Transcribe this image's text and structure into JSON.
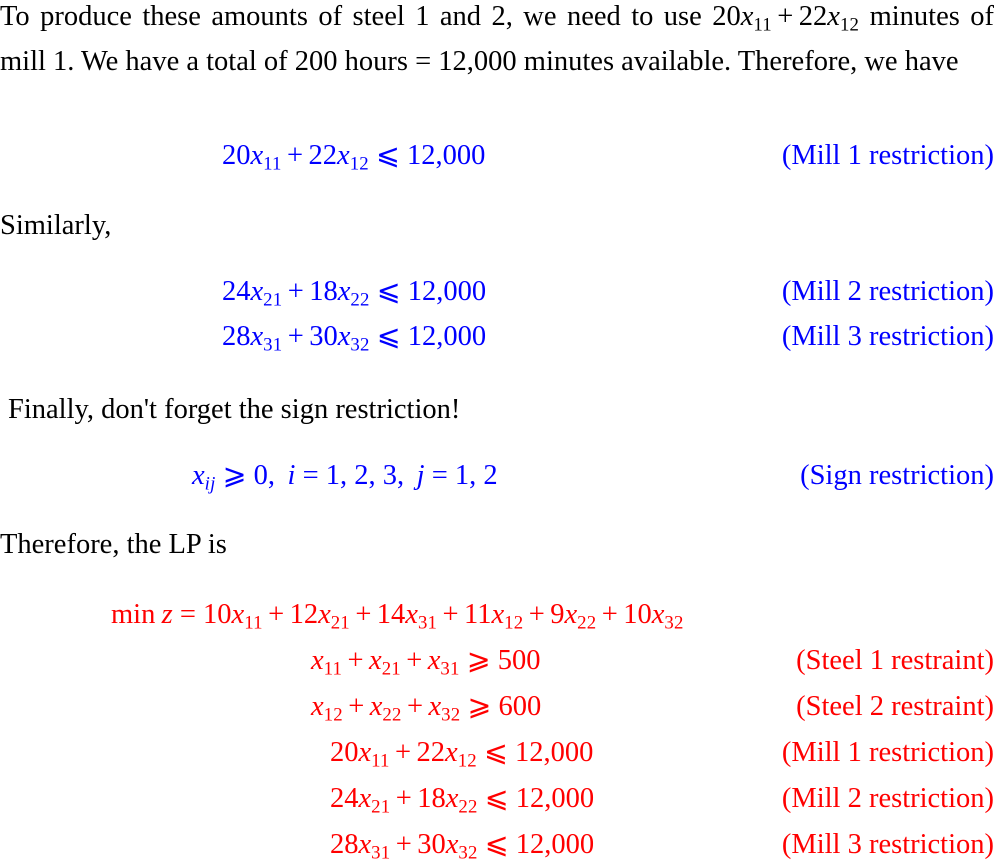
{
  "document": {
    "title": "Linear Programming formulation - steel mill problem",
    "colors": {
      "text": "#000000",
      "blue": "#0000ff",
      "red": "#ff0000",
      "background": "#ffffff"
    }
  },
  "paragraphs": {
    "intro": "To produce these amounts of steel 1 and 2, we need to use 20x11 + 22x12 minutes of mill 1. We have a total of 200 hours = 12,000 minutes available. Therefore, we have",
    "similarly": "Similarly,",
    "finally": "Finally, don't forget the sign restriction!",
    "therefore_lp": "Therefore, the LP is"
  },
  "intro_text": {
    "part1": "To produce these amounts of steel 1 and 2, we need to use ",
    "math1_coef1": "20",
    "math1_var1": "x",
    "math1_sub1": "11",
    "math1_op": "+",
    "math1_coef2": "22",
    "math1_var2": "x",
    "math1_sub2": "12",
    "part2": "minutes of mill 1. We have a total of 200 hours = 12,000 minutes available. Therefore, we have"
  },
  "equations": {
    "mill1_blue": {
      "coef1": "20",
      "var1": "x",
      "sub1": "11",
      "op": "+",
      "coef2": "22",
      "var2": "x",
      "sub2": "12",
      "rel": "⩽",
      "rhs": "12,000",
      "tag": "(Mill 1 restriction)",
      "color": "#0000ff"
    },
    "mill2_blue": {
      "coef1": "24",
      "var1": "x",
      "sub1": "21",
      "op": "+",
      "coef2": "18",
      "var2": "x",
      "sub2": "22",
      "rel": "⩽",
      "rhs": "12,000",
      "tag": "(Mill 2 restriction)",
      "color": "#0000ff"
    },
    "mill3_blue": {
      "coef1": "28",
      "var1": "x",
      "sub1": "31",
      "op": "+",
      "coef2": "30",
      "var2": "x",
      "sub2": "32",
      "rel": "⩽",
      "rhs": "12,000",
      "tag": "(Mill 3 restriction)",
      "color": "#0000ff"
    },
    "sign_blue": {
      "var": "x",
      "sub": "ij",
      "rel": "⩾",
      "rhs": "0,",
      "i_label": "i",
      "i_values": "1, 2, 3,",
      "j_label": "j",
      "j_values": "1, 2",
      "eq": "=",
      "tag": "(Sign restriction)",
      "color": "#0000ff"
    },
    "objective_red": {
      "min": "min",
      "z": "z",
      "eq": "=",
      "terms": [
        {
          "coef": "10",
          "var": "x",
          "sub": "11"
        },
        {
          "coef": "12",
          "var": "x",
          "sub": "21"
        },
        {
          "coef": "14",
          "var": "x",
          "sub": "31"
        },
        {
          "coef": "11",
          "var": "x",
          "sub": "12"
        },
        {
          "coef": "9",
          "var": "x",
          "sub": "22"
        },
        {
          "coef": "10",
          "var": "x",
          "sub": "32"
        }
      ],
      "op": "+",
      "color": "#ff0000"
    },
    "steel1_red": {
      "var1": "x",
      "sub1": "11",
      "var2": "x",
      "sub2": "21",
      "var3": "x",
      "sub3": "31",
      "op": "+",
      "rel": "⩾",
      "rhs": "500",
      "tag": "(Steel 1 restraint)",
      "color": "#ff0000"
    },
    "steel2_red": {
      "var1": "x",
      "sub1": "12",
      "var2": "x",
      "sub2": "22",
      "var3": "x",
      "sub3": "32",
      "op": "+",
      "rel": "⩾",
      "rhs": "600",
      "tag": "(Steel 2 restraint)",
      "color": "#ff0000"
    },
    "mill1_red": {
      "coef1": "20",
      "var1": "x",
      "sub1": "11",
      "op": "+",
      "coef2": "22",
      "var2": "x",
      "sub2": "12",
      "rel": "⩽",
      "rhs": "12,000",
      "tag": "(Mill 1 restriction)",
      "color": "#ff0000"
    },
    "mill2_red": {
      "coef1": "24",
      "var1": "x",
      "sub1": "21",
      "op": "+",
      "coef2": "18",
      "var2": "x",
      "sub2": "22",
      "rel": "⩽",
      "rhs": "12,000",
      "tag": "(Mill 2 restriction)",
      "color": "#ff0000"
    },
    "mill3_red": {
      "coef1": "28",
      "var1": "x",
      "sub1": "31",
      "op": "+",
      "coef2": "30",
      "var2": "x",
      "sub2": "32",
      "rel": "⩽",
      "rhs": "12,000",
      "tag": "(Mill 3 restriction)",
      "color": "#ff0000"
    }
  }
}
